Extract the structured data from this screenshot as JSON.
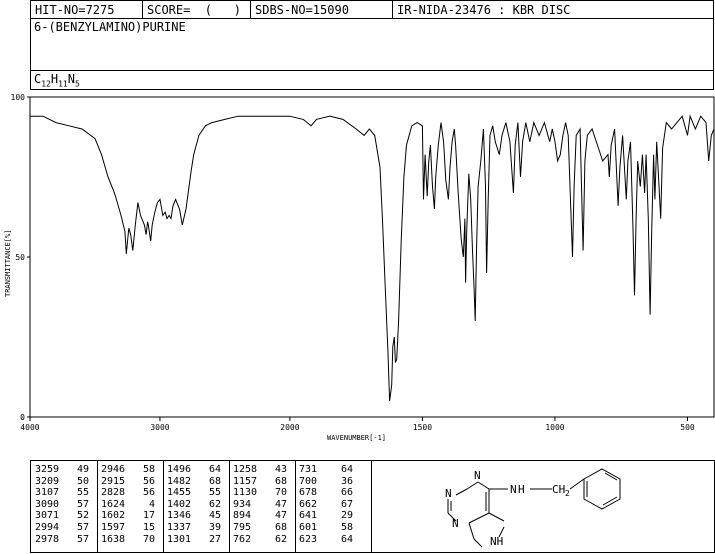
{
  "header": {
    "hit_no": "HIT-NO=7275",
    "score": "SCORE=  (   )",
    "sdbs_no": "SDBS-NO=15090",
    "ir_info": "IR-NIDA-23476 : KBR DISC"
  },
  "compound": {
    "name": "6-(BENZYLAMINO)PURINE",
    "formula_parts": [
      {
        "t": "C",
        "sub": false
      },
      {
        "t": "12",
        "sub": true
      },
      {
        "t": "H",
        "sub": false
      },
      {
        "t": "11",
        "sub": true
      },
      {
        "t": "N",
        "sub": false
      },
      {
        "t": "5",
        "sub": true
      }
    ]
  },
  "chart_data": {
    "type": "line",
    "title": "",
    "xlabel": "WAVENUMBER[-1]",
    "ylabel": "TRANSMITTANCE[%]",
    "xlim": [
      4000,
      400
    ],
    "ylim": [
      0,
      100
    ],
    "xticks": [
      4000,
      3000,
      2000,
      1500,
      1000,
      500
    ],
    "yticks": [
      0,
      50,
      100
    ],
    "grid": false,
    "series": [
      {
        "points": [
          [
            4000,
            94
          ],
          [
            3900,
            94
          ],
          [
            3800,
            92
          ],
          [
            3700,
            91
          ],
          [
            3600,
            90
          ],
          [
            3500,
            87
          ],
          [
            3450,
            82
          ],
          [
            3400,
            75
          ],
          [
            3350,
            70
          ],
          [
            3300,
            63
          ],
          [
            3270,
            58
          ],
          [
            3259,
            51
          ],
          [
            3240,
            59
          ],
          [
            3225,
            57
          ],
          [
            3209,
            52
          ],
          [
            3190,
            60
          ],
          [
            3170,
            67
          ],
          [
            3150,
            63
          ],
          [
            3120,
            60
          ],
          [
            3107,
            57
          ],
          [
            3095,
            61
          ],
          [
            3090,
            60
          ],
          [
            3071,
            55
          ],
          [
            3060,
            60
          ],
          [
            3040,
            64
          ],
          [
            3020,
            67
          ],
          [
            3000,
            68
          ],
          [
            2978,
            63
          ],
          [
            2960,
            64
          ],
          [
            2946,
            62
          ],
          [
            2930,
            63
          ],
          [
            2915,
            62
          ],
          [
            2900,
            66
          ],
          [
            2880,
            68
          ],
          [
            2850,
            65
          ],
          [
            2828,
            60
          ],
          [
            2800,
            65
          ],
          [
            2780,
            71
          ],
          [
            2760,
            77
          ],
          [
            2740,
            82
          ],
          [
            2700,
            88
          ],
          [
            2650,
            91
          ],
          [
            2600,
            92
          ],
          [
            2500,
            93
          ],
          [
            2400,
            94
          ],
          [
            2300,
            94
          ],
          [
            2200,
            94
          ],
          [
            2100,
            94
          ],
          [
            2000,
            94
          ],
          [
            1950,
            93
          ],
          [
            1920,
            91
          ],
          [
            1900,
            93
          ],
          [
            1850,
            94
          ],
          [
            1800,
            93
          ],
          [
            1750,
            90
          ],
          [
            1720,
            88
          ],
          [
            1700,
            90
          ],
          [
            1680,
            88
          ],
          [
            1660,
            78
          ],
          [
            1650,
            60
          ],
          [
            1640,
            40
          ],
          [
            1630,
            20
          ],
          [
            1624,
            5
          ],
          [
            1616,
            10
          ],
          [
            1612,
            22
          ],
          [
            1606,
            25
          ],
          [
            1602,
            17
          ],
          [
            1597,
            18
          ],
          [
            1590,
            30
          ],
          [
            1580,
            55
          ],
          [
            1570,
            75
          ],
          [
            1560,
            85
          ],
          [
            1540,
            91
          ],
          [
            1520,
            92
          ],
          [
            1500,
            91
          ],
          [
            1496,
            68
          ],
          [
            1490,
            82
          ],
          [
            1482,
            69
          ],
          [
            1476,
            80
          ],
          [
            1470,
            85
          ],
          [
            1462,
            72
          ],
          [
            1455,
            65
          ],
          [
            1450,
            75
          ],
          [
            1440,
            85
          ],
          [
            1430,
            92
          ],
          [
            1420,
            86
          ],
          [
            1412,
            74
          ],
          [
            1402,
            68
          ],
          [
            1396,
            78
          ],
          [
            1388,
            86
          ],
          [
            1380,
            90
          ],
          [
            1375,
            85
          ],
          [
            1365,
            70
          ],
          [
            1354,
            56
          ],
          [
            1346,
            50
          ],
          [
            1340,
            62
          ],
          [
            1337,
            42
          ],
          [
            1333,
            58
          ],
          [
            1325,
            76
          ],
          [
            1318,
            68
          ],
          [
            1311,
            52
          ],
          [
            1305,
            40
          ],
          [
            1301,
            30
          ],
          [
            1296,
            52
          ],
          [
            1290,
            72
          ],
          [
            1280,
            80
          ],
          [
            1270,
            90
          ],
          [
            1262,
            72
          ],
          [
            1258,
            45
          ],
          [
            1252,
            68
          ],
          [
            1245,
            88
          ],
          [
            1235,
            91
          ],
          [
            1225,
            86
          ],
          [
            1210,
            82
          ],
          [
            1200,
            88
          ],
          [
            1185,
            92
          ],
          [
            1170,
            86
          ],
          [
            1157,
            70
          ],
          [
            1150,
            85
          ],
          [
            1140,
            92
          ],
          [
            1130,
            75
          ],
          [
            1122,
            86
          ],
          [
            1110,
            92
          ],
          [
            1095,
            86
          ],
          [
            1080,
            92
          ],
          [
            1060,
            88
          ],
          [
            1040,
            92
          ],
          [
            1020,
            86
          ],
          [
            1010,
            90
          ],
          [
            1000,
            86
          ],
          [
            990,
            80
          ],
          [
            980,
            82
          ],
          [
            970,
            88
          ],
          [
            960,
            92
          ],
          [
            950,
            88
          ],
          [
            934,
            50
          ],
          [
            928,
            72
          ],
          [
            920,
            88
          ],
          [
            905,
            90
          ],
          [
            894,
            52
          ],
          [
            887,
            80
          ],
          [
            878,
            88
          ],
          [
            860,
            90
          ],
          [
            840,
            85
          ],
          [
            820,
            80
          ],
          [
            800,
            82
          ],
          [
            795,
            75
          ],
          [
            788,
            85
          ],
          [
            775,
            90
          ],
          [
            762,
            66
          ],
          [
            755,
            78
          ],
          [
            745,
            88
          ],
          [
            731,
            68
          ],
          [
            725,
            80
          ],
          [
            715,
            86
          ],
          [
            706,
            60
          ],
          [
            700,
            38
          ],
          [
            694,
            62
          ],
          [
            688,
            80
          ],
          [
            678,
            72
          ],
          [
            670,
            82
          ],
          [
            662,
            70
          ],
          [
            656,
            82
          ],
          [
            648,
            62
          ],
          [
            641,
            32
          ],
          [
            635,
            58
          ],
          [
            628,
            82
          ],
          [
            623,
            68
          ],
          [
            616,
            86
          ],
          [
            601,
            62
          ],
          [
            594,
            84
          ],
          [
            580,
            92
          ],
          [
            560,
            90
          ],
          [
            540,
            92
          ],
          [
            520,
            94
          ],
          [
            500,
            88
          ],
          [
            490,
            94
          ],
          [
            470,
            90
          ],
          [
            450,
            94
          ],
          [
            430,
            92
          ],
          [
            420,
            80
          ],
          [
            410,
            88
          ],
          [
            400,
            90
          ]
        ]
      }
    ]
  },
  "peaks": {
    "columns": [
      [
        [
          "3259",
          "49"
        ],
        [
          "3209",
          "50"
        ],
        [
          "3107",
          "55"
        ],
        [
          "3090",
          "57"
        ],
        [
          "3071",
          "52"
        ],
        [
          "2994",
          "57"
        ],
        [
          "2978",
          "57"
        ]
      ],
      [
        [
          "2946",
          "58"
        ],
        [
          "2915",
          "56"
        ],
        [
          "2828",
          "56"
        ],
        [
          "1624",
          "4"
        ],
        [
          "1602",
          "17"
        ],
        [
          "1597",
          "15"
        ],
        [
          "1638",
          "70"
        ]
      ],
      [
        [
          "1496",
          "64"
        ],
        [
          "1482",
          "68"
        ],
        [
          "1455",
          "55"
        ],
        [
          "1402",
          "62"
        ],
        [
          "1346",
          "45"
        ],
        [
          "1337",
          "39"
        ],
        [
          "1301",
          "27"
        ]
      ],
      [
        [
          "1258",
          "43"
        ],
        [
          "1157",
          "68"
        ],
        [
          "1130",
          "70"
        ],
        [
          "934",
          "47"
        ],
        [
          "894",
          "47"
        ],
        [
          "795",
          "68"
        ],
        [
          "762",
          "62"
        ]
      ],
      [
        [
          "731",
          "64"
        ],
        [
          "700",
          "36"
        ],
        [
          "678",
          "66"
        ],
        [
          "662",
          "67"
        ],
        [
          "641",
          "29"
        ],
        [
          "601",
          "58"
        ],
        [
          "623",
          "64"
        ]
      ]
    ]
  },
  "structure": {
    "atom_n1": "N",
    "atom_n2": "N",
    "atom_n3": "N",
    "atom_nh": "NH",
    "atom_n_amine": "N",
    "atom_h_amine": "H",
    "atom_ch2": "CH",
    "atom_ch2_sub": "2"
  }
}
